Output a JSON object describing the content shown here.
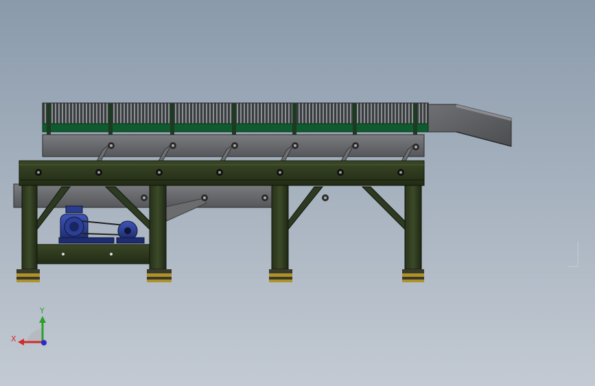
{
  "viewport": {
    "background_top": "#8a9aab",
    "background_bottom": "#c3cad3"
  },
  "model": {
    "frame_color": "#2f3a1f",
    "frame_dark": "#1d2412",
    "pan_color": "#6a6c6e",
    "cover_color": "#0f5a2e",
    "motor_color": "#2a3c8c",
    "pad_color": "#b0922a",
    "icons": [
      "screening-frame",
      "vibrating-pan",
      "drive-motor",
      "discharge-chute"
    ]
  },
  "triad": {
    "x_label": "X",
    "y_label": "Y",
    "x_color": "#d42a2a",
    "y_color": "#2aa02a",
    "z_color": "#2a2acf"
  }
}
